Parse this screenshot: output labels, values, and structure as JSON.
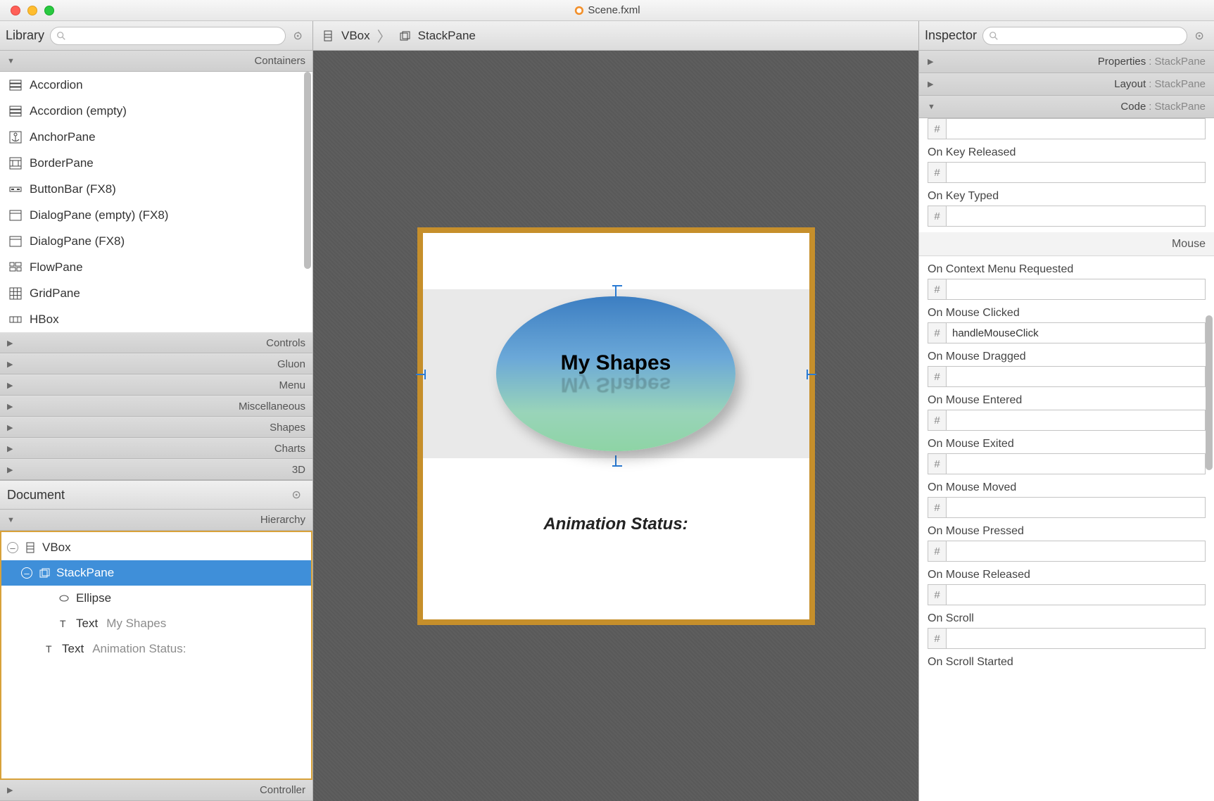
{
  "window": {
    "title": "Scene.fxml"
  },
  "library": {
    "title": "Library",
    "categories": {
      "containers": "Containers",
      "controls": "Controls",
      "gluon": "Gluon",
      "menu": "Menu",
      "misc": "Miscellaneous",
      "shapes": "Shapes",
      "charts": "Charts",
      "d3": "3D"
    },
    "containers_items": [
      "Accordion",
      "Accordion  (empty)",
      "AnchorPane",
      "BorderPane",
      "ButtonBar  (FX8)",
      "DialogPane (empty)  (FX8)",
      "DialogPane  (FX8)",
      "FlowPane",
      "GridPane",
      "HBox"
    ]
  },
  "document": {
    "title": "Document",
    "hierarchy_label": "Hierarchy",
    "controller_label": "Controller",
    "nodes": {
      "vbox": "VBox",
      "stackpane": "StackPane",
      "ellipse": "Ellipse",
      "text1": "Text",
      "text1_val": "My Shapes",
      "text2": "Text",
      "text2_val": "Animation Status:"
    }
  },
  "breadcrumb": {
    "vbox": "VBox",
    "stackpane": "StackPane"
  },
  "canvas": {
    "ellipse_text": "My Shapes",
    "status_text": "Animation Status:"
  },
  "inspector": {
    "title": "Inspector",
    "sections": {
      "properties": {
        "label": "Properties",
        "sub": "StackPane"
      },
      "layout": {
        "label": "Layout",
        "sub": "StackPane"
      },
      "code": {
        "label": "Code",
        "sub": "StackPane"
      }
    },
    "group_mouse": "Mouse",
    "fields": {
      "onKeyReleased": {
        "label": "On Key Released",
        "value": ""
      },
      "onKeyTyped": {
        "label": "On Key Typed",
        "value": ""
      },
      "onContextMenuRequested": {
        "label": "On Context Menu Requested",
        "value": ""
      },
      "onMouseClicked": {
        "label": "On Mouse Clicked",
        "value": "handleMouseClick"
      },
      "onMouseDragged": {
        "label": "On Mouse Dragged",
        "value": ""
      },
      "onMouseEntered": {
        "label": "On Mouse Entered",
        "value": ""
      },
      "onMouseExited": {
        "label": "On Mouse Exited",
        "value": ""
      },
      "onMouseMoved": {
        "label": "On Mouse Moved",
        "value": ""
      },
      "onMousePressed": {
        "label": "On Mouse Pressed",
        "value": ""
      },
      "onMouseReleased": {
        "label": "On Mouse Released",
        "value": ""
      },
      "onScroll": {
        "label": "On Scroll",
        "value": ""
      },
      "onScrollStarted": {
        "label": "On Scroll Started",
        "value": ""
      }
    },
    "hash": "#"
  }
}
